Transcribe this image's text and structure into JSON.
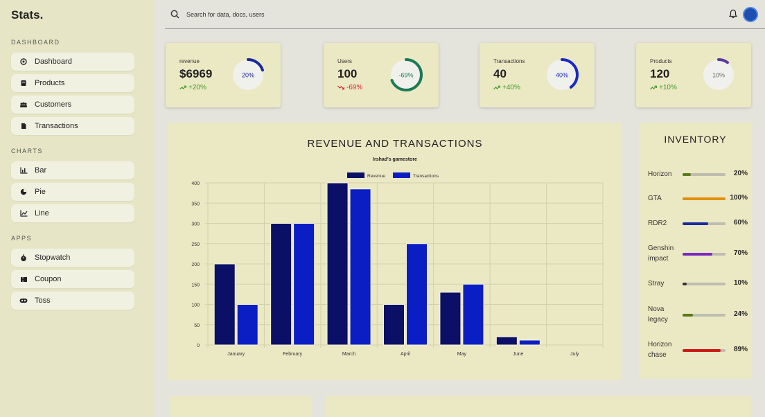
{
  "app": {
    "logo": "Stats."
  },
  "search": {
    "placeholder": "Search for data, docs, users"
  },
  "sidebar": {
    "sections": [
      {
        "title": "DASHBOARD",
        "items": [
          {
            "label": "Dashboard",
            "icon": "dashboard-icon"
          },
          {
            "label": "Products",
            "icon": "products-icon"
          },
          {
            "label": "Customers",
            "icon": "customers-icon"
          },
          {
            "label": "Transactions",
            "icon": "transactions-icon"
          }
        ]
      },
      {
        "title": "CHARTS",
        "items": [
          {
            "label": "Bar",
            "icon": "bar-chart-icon"
          },
          {
            "label": "Pie",
            "icon": "pie-chart-icon"
          },
          {
            "label": "Line",
            "icon": "line-chart-icon"
          }
        ]
      },
      {
        "title": "APPS",
        "items": [
          {
            "label": "Stopwatch",
            "icon": "stopwatch-icon"
          },
          {
            "label": "Coupon",
            "icon": "coupon-icon"
          },
          {
            "label": "Toss",
            "icon": "toss-icon"
          }
        ]
      }
    ]
  },
  "stats": [
    {
      "label": "revenue",
      "value": "$6969",
      "change": "+20%",
      "trend": "up",
      "percent": 20,
      "ring_text": "20%",
      "color": "#1a2a9a"
    },
    {
      "label": "Users",
      "value": "100",
      "change": "-69%",
      "trend": "down",
      "percent": 69,
      "ring_text": "-69%",
      "color": "#1a7a55"
    },
    {
      "label": "Transactions",
      "value": "40",
      "change": "+40%",
      "trend": "up",
      "percent": 40,
      "ring_text": "40%",
      "color": "#1a2ac0"
    },
    {
      "label": "Products",
      "value": "120",
      "change": "+10%",
      "trend": "up",
      "percent": 10,
      "ring_text": "10%",
      "color": "#5a3a9a"
    }
  ],
  "chart_data": {
    "type": "bar",
    "title": "REVENUE AND TRANSACTIONS",
    "subtitle": "Irshad's gamestore",
    "categories": [
      "January",
      "February",
      "March",
      "April",
      "May",
      "June",
      "July"
    ],
    "series": [
      {
        "name": "Revenue",
        "values": [
          200,
          300,
          400,
          100,
          130,
          20,
          0
        ],
        "color": "#0c0f66"
      },
      {
        "name": "Transactions",
        "values": [
          100,
          300,
          385,
          250,
          150,
          12,
          0
        ],
        "color": "#0a1ec4"
      }
    ],
    "ylim": [
      0,
      400
    ],
    "yticks": [
      0,
      50,
      100,
      150,
      200,
      250,
      300,
      350,
      400
    ],
    "legend": "top-center",
    "grid": true
  },
  "inventory": {
    "title": "INVENTORY",
    "items": [
      {
        "name": "Horizon",
        "percent": 20,
        "label": "20%",
        "color": "#5a7a1a"
      },
      {
        "name": "GTA",
        "percent": 100,
        "label": "100%",
        "color": "#e0900e"
      },
      {
        "name": "RDR2",
        "percent": 60,
        "label": "60%",
        "color": "#1a2aa0"
      },
      {
        "name": "Genshin impact",
        "percent": 70,
        "label": "70%",
        "color": "#7a2ac0"
      },
      {
        "name": "Stray",
        "percent": 10,
        "label": "10%",
        "color": "#333333"
      },
      {
        "name": "Nova legacy",
        "percent": 24,
        "label": "24%",
        "color": "#5a7a1a"
      },
      {
        "name": "Horizon chase",
        "percent": 89,
        "label": "89%",
        "color": "#d01818"
      }
    ]
  }
}
